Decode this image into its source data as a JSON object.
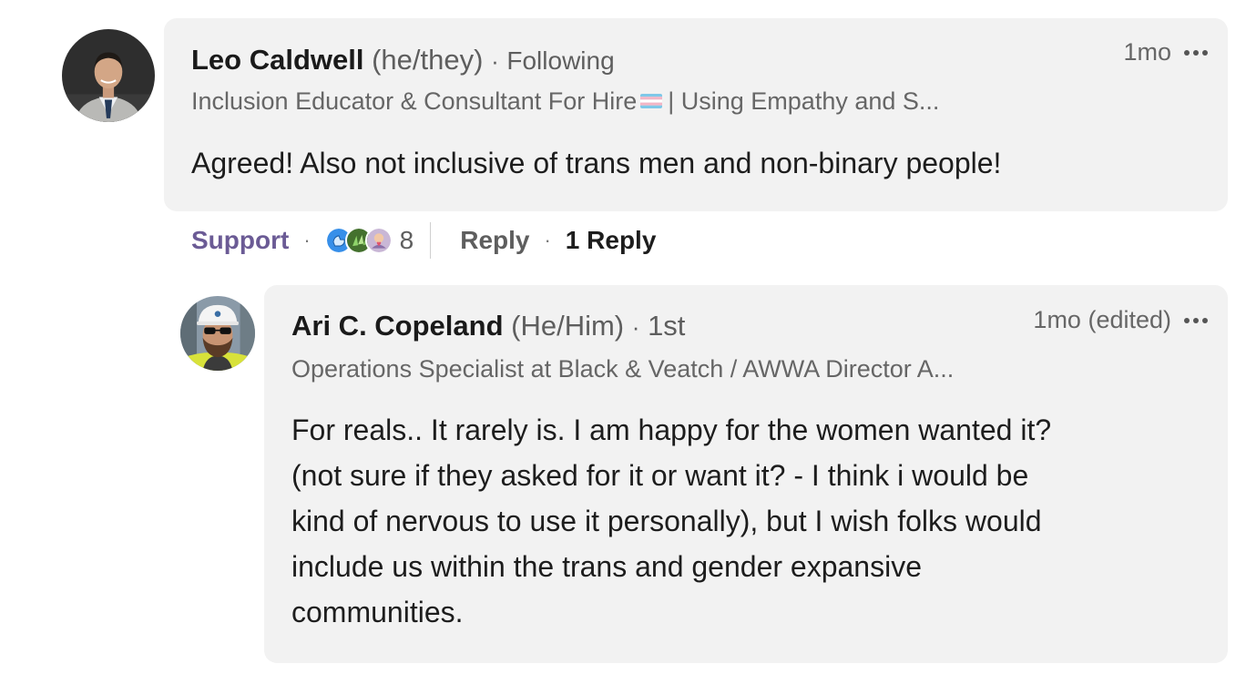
{
  "comment": {
    "author_name": "Leo Caldwell",
    "pronouns": "(he/they)",
    "relation": "Following",
    "headline_before_flag": "Inclusion Educator & Consultant For Hire",
    "headline_after_flag": "| Using Empathy and S...",
    "time": "1mo",
    "text": "Agreed! Also not inclusive of trans men and non-binary people!",
    "actions": {
      "support_label": "Support",
      "reaction_count": "8",
      "reply_label": "Reply",
      "replies_label": "1 Reply"
    },
    "reaction_icons": [
      "support-reaction-icon",
      "celebrate-reaction-icon",
      "love-reaction-icon"
    ]
  },
  "reply": {
    "author_name": "Ari C. Copeland",
    "pronouns": "(He/Him)",
    "degree": "1st",
    "headline": "Operations Specialist at Black & Veatch / AWWA Director A...",
    "time": "1mo (edited)",
    "lines": [
      "For reals.. It rarely is. I am happy for the women wanted it?",
      "(not sure if they asked for it or want it? - I think i would be",
      "kind of nervous to use it personally), but I wish folks would",
      "include us within the trans and gender expansive",
      "communities."
    ]
  },
  "colors": {
    "bubble_bg": "#f2f2f2",
    "support_purple": "#6b5b95",
    "muted_text": "#666666",
    "body_text": "#1d1d1d"
  }
}
